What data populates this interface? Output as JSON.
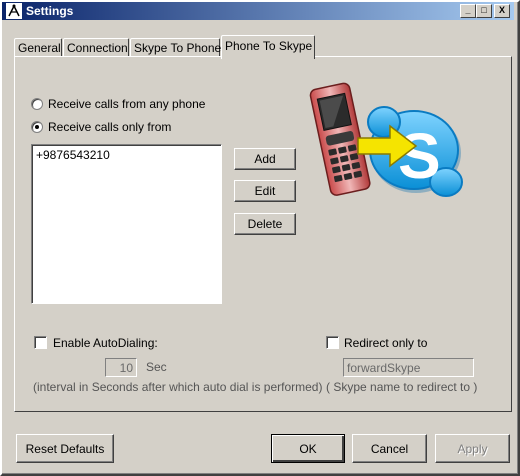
{
  "window": {
    "title": "Settings",
    "minimize_glyph": "_",
    "maximize_glyph": "□",
    "close_glyph": "X"
  },
  "tabs": [
    {
      "label": "General",
      "active": false
    },
    {
      "label": "Connection",
      "active": false
    },
    {
      "label": "Skype To Phone",
      "active": false
    },
    {
      "label": "Phone To Skype",
      "active": true
    }
  ],
  "panel": {
    "radio_any": {
      "label": "Receive calls from any phone",
      "checked": false
    },
    "radio_only": {
      "label": "Receive calls only from",
      "checked": true
    },
    "numbers": [
      "+9876543210"
    ],
    "add_label": "Add",
    "edit_label": "Edit",
    "delete_label": "Delete",
    "illustration": "phone-to-skype-icon",
    "autodial": {
      "label": "Enable AutoDialing:",
      "checked": false,
      "value": "10",
      "unit": "Sec",
      "hint": "(interval in Seconds after which auto dial is performed)"
    },
    "redirect": {
      "label": "Redirect only to",
      "checked": false,
      "value": "forwardSkype",
      "hint": "( Skype name to redirect to )"
    }
  },
  "footer": {
    "reset_label": "Reset Defaults",
    "ok_label": "OK",
    "cancel_label": "Cancel",
    "apply_label": "Apply"
  },
  "colors": {
    "face": "#d4d0c8",
    "title_start": "#0a246a",
    "title_end": "#a6caf0",
    "skype_blue": "#1fa3e6",
    "arrow_yellow": "#f5e400"
  }
}
